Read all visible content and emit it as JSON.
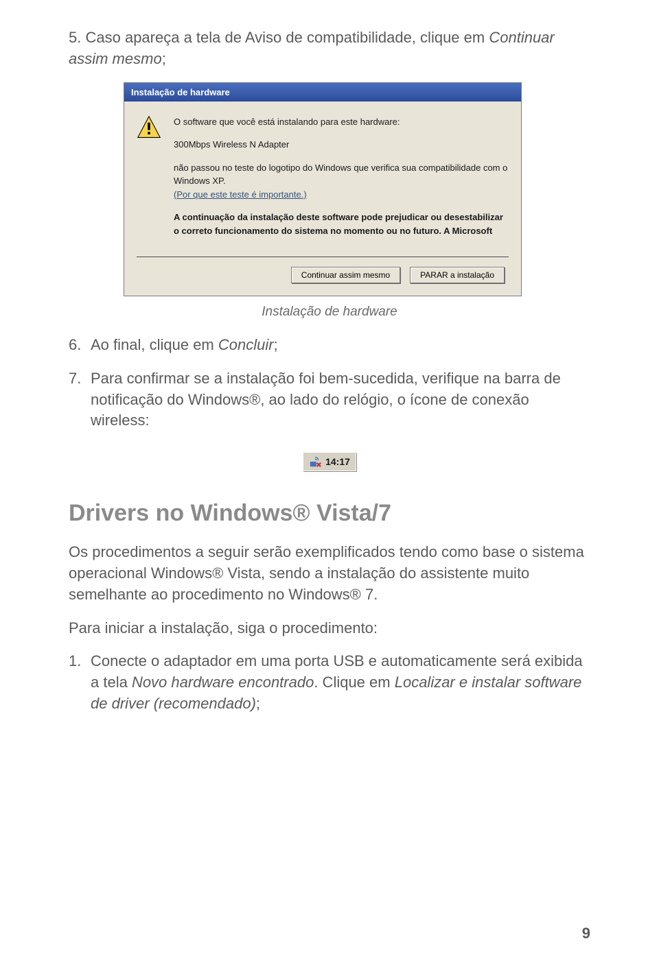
{
  "step5": {
    "num": "5.",
    "text_a": "Caso apareça a tela de Aviso de compatibilidade, clique em ",
    "text_b": "Continuar assim mesmo",
    "text_c": ";"
  },
  "dialog": {
    "title": "Instalação de hardware",
    "line1": "O software que você está instalando para este hardware:",
    "device": "300Mbps Wireless N Adapter",
    "line3a": "não passou no teste do logotipo do Windows que verifica sua compatibilidade com o Windows XP.",
    "link": "(Por que este teste é importante.)",
    "bold": "A continuação da instalação deste software pode prejudicar ou desestabilizar o correto funcionamento do sistema no momento ou no futuro. A Microsoft",
    "btn_continue": "Continuar assim mesmo",
    "btn_stop": "PARAR a instalação"
  },
  "caption": "Instalação de hardware",
  "step6": {
    "num": "6.",
    "text_a": "Ao final, clique em ",
    "text_b": "Concluir",
    "text_c": ";"
  },
  "step7": {
    "num": "7.",
    "text": "Para confirmar se a instalação foi bem-sucedida, verifique na barra de notificação do Windows®, ao lado do relógio, o ícone de conexão wireless:"
  },
  "tray": {
    "time": "14:17"
  },
  "section": {
    "title": "Drivers no Windows® Vista/7",
    "p1": "Os procedimentos a seguir serão exemplificados tendo como base o sistema operacional Windows® Vista, sendo a instalação do assistente muito semelhante ao procedimento no Windows® 7.",
    "p2": "Para iniciar a instalação, siga o procedimento:"
  },
  "step1b": {
    "num": "1.",
    "text_a": "Conecte o adaptador em uma porta USB e automaticamente será exibida a tela ",
    "text_b": "Novo hardware encontrado",
    "text_c": ". Clique em ",
    "text_d": "Localizar e instalar software de driver (recomendado)",
    "text_e": ";"
  },
  "page_num": "9"
}
